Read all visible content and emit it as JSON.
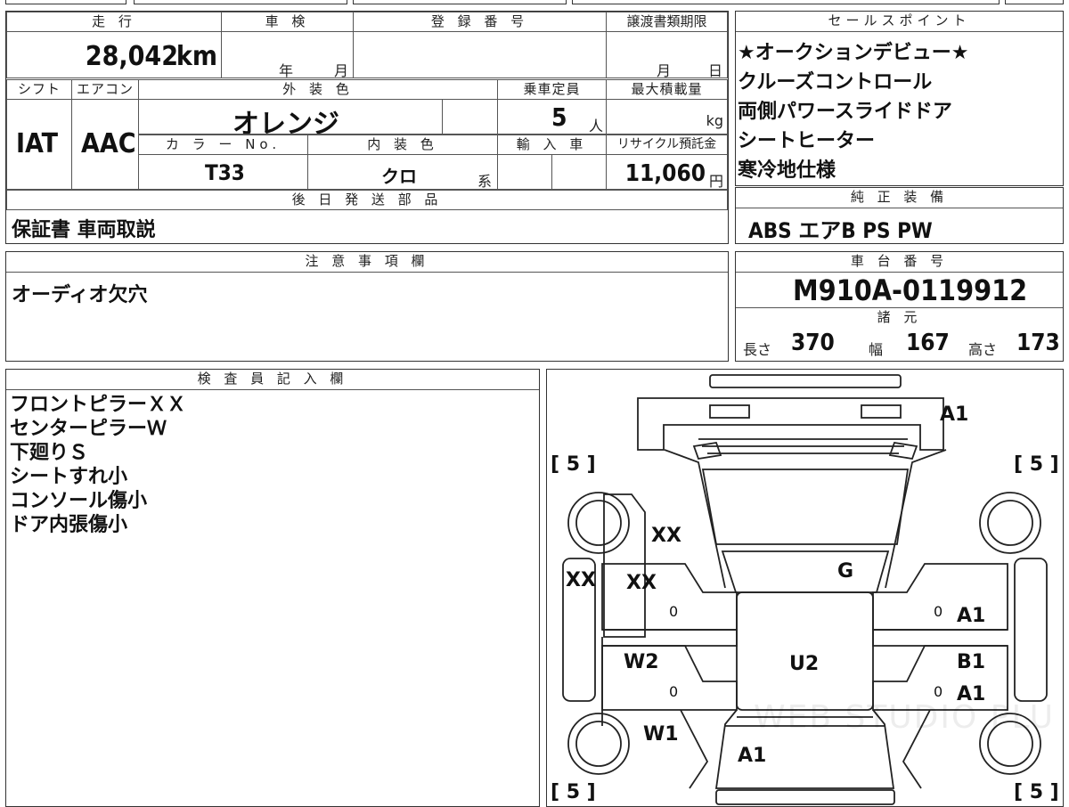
{
  "top_info": {
    "mileage_header": "走 行",
    "mileage_value": "28,042",
    "mileage_unit": "km",
    "shaken_header": "車 検",
    "shaken_year": "年",
    "shaken_month": "月",
    "registration_header": "登 録 番 号",
    "registration_value": "",
    "transfer_header": "譲渡書類期限",
    "transfer_month": "月",
    "transfer_day": "日",
    "shift_header": "シフト",
    "shift_value": "IAT",
    "aircon_header": "エアコン",
    "aircon_value": "AAC",
    "exterior_color_header": "外 装 色",
    "exterior_color_value": "オレンジ",
    "capacity_header": "乗車定員",
    "capacity_value": "5",
    "capacity_unit": "人",
    "max_load_header": "最大積載量",
    "max_load_value": "",
    "max_load_unit": "kg",
    "color_no_header": "カ ラ ー No.",
    "color_no_value": "T33",
    "interior_color_header": "内 装 色",
    "interior_color_value": "クロ",
    "interior_color_suffix": "系",
    "import_header": "輸 入 車",
    "import_value": "",
    "recycle_header": "リサイクル預託金",
    "recycle_value": "11,060",
    "recycle_unit": "円",
    "later_parts_header": "後 日 発 送 部 品",
    "later_parts_value": "保証書 車両取説"
  },
  "sales_points": {
    "header": "セールスポイント",
    "items": [
      "★オークションデビュー★",
      "クルーズコントロール",
      "両側パワースライドドア",
      "シートヒーター",
      "寒冷地仕様"
    ]
  },
  "genuine_equipment": {
    "header": "純 正 装 備",
    "value": "ABS エアB PS PW"
  },
  "caution": {
    "header": "注 意 事 項 欄",
    "value": "オーディオ欠穴"
  },
  "chassis": {
    "header": "車 台 番 号",
    "value": "M910A-0119912"
  },
  "specs": {
    "header": "諸 元",
    "length_label": "長さ",
    "length_value": "370",
    "width_label": "幅",
    "width_value": "167",
    "height_label": "高さ",
    "height_value": "173"
  },
  "inspector": {
    "header": "検 査 員 記 入 欄",
    "lines": [
      "フロントピラーＸＸ",
      "センターピラーＷ",
      "下廻りＳ",
      "シートすれ小",
      "コンソール傷小",
      "ドア内張傷小"
    ]
  },
  "diagram": {
    "tire_marks": [
      "[ 5 ]",
      "[ 5 ]",
      "[ 5 ]",
      "[ 5 ]"
    ],
    "damage_marks": {
      "front_bumper": "A1",
      "front_pillar": "XX",
      "left_side": "XX",
      "left_front_door": "XX",
      "left_rear_door": "W2",
      "left_rear": "W1",
      "roof": "G",
      "floor": "U2",
      "right_front_door": "A1",
      "right_rear_door_top": "B1",
      "right_rear_door": "A1",
      "rear": "A1"
    },
    "zero_marks": [
      "0",
      "0",
      "0",
      "0"
    ],
    "watermark": "WEB STUDIO PLU"
  }
}
